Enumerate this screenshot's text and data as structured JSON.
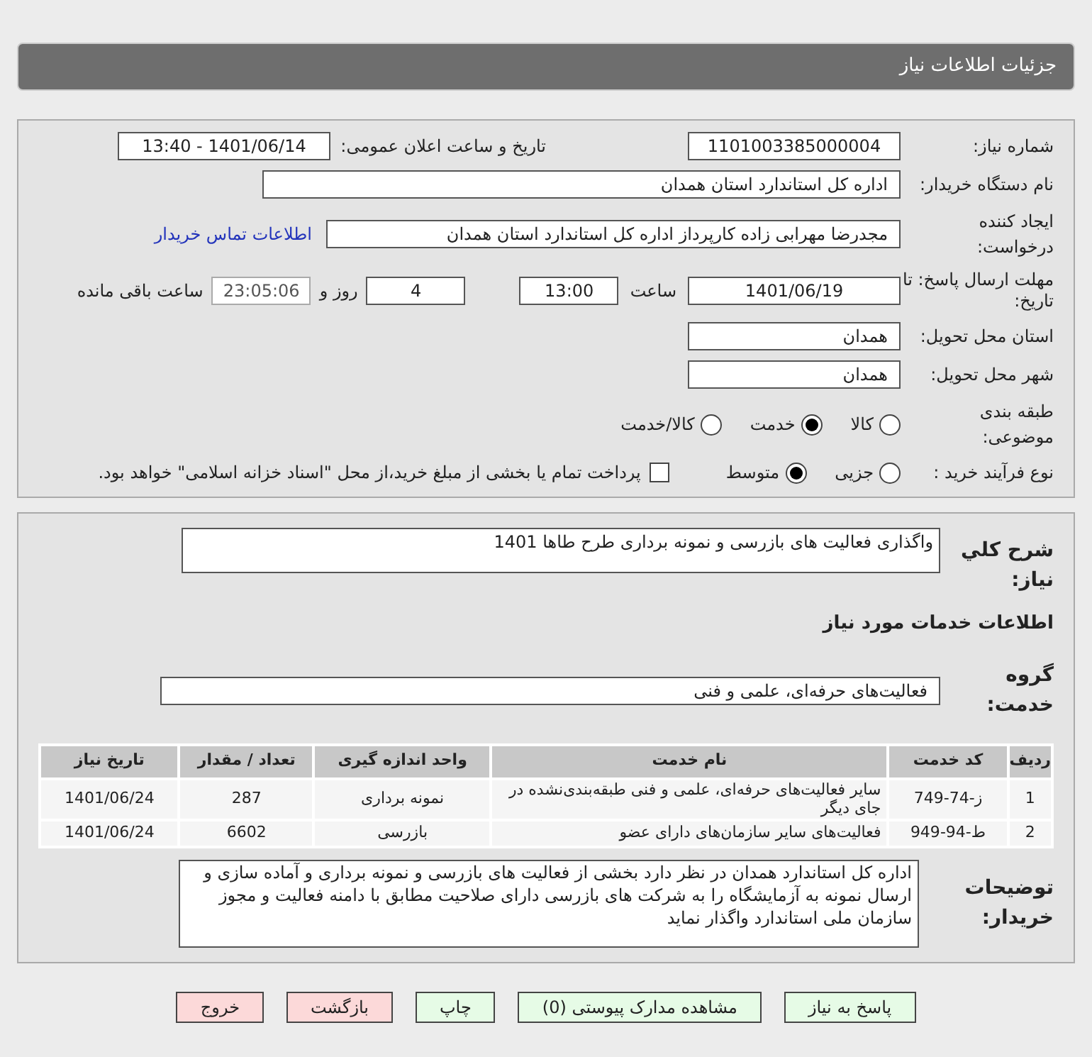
{
  "header": {
    "title": "جزئیات اطلاعات نیاز"
  },
  "fields": {
    "need_number": {
      "label": "شماره نیاز:",
      "value": "1101003385000004"
    },
    "announce": {
      "label": "تاریخ و ساعت اعلان عمومی:",
      "value": "1401/06/14 - 13:40"
    },
    "buyer": {
      "label": "نام دستگاه خریدار:",
      "value": "اداره کل استاندارد استان همدان"
    },
    "creator": {
      "label": "ایجاد کننده درخواست:",
      "value": "مجدرضا مهرابی زاده کارپرداز اداره کل استاندارد استان همدان",
      "link": "اطلاعات تماس خریدار"
    },
    "deadline": {
      "label": "مهلت ارسال پاسخ: تا تاریخ:",
      "date": "1401/06/19",
      "time_label": "ساعت",
      "time": "13:00",
      "days": "4",
      "days_label": "روز و",
      "remaining": "23:05:06",
      "remaining_label": "ساعت باقی مانده"
    },
    "province": {
      "label": "استان محل تحویل:",
      "value": "همدان"
    },
    "city": {
      "label": "شهر محل تحویل:",
      "value": "همدان"
    },
    "category": {
      "label": "طبقه بندی موضوعی:",
      "options": [
        {
          "label": "کالا",
          "selected": false
        },
        {
          "label": "خدمت",
          "selected": true
        },
        {
          "label": "کالا/خدمت",
          "selected": false
        }
      ]
    },
    "process": {
      "label": "نوع فرآیند خرید :",
      "options": [
        {
          "label": "جزیی",
          "selected": false
        },
        {
          "label": "متوسط",
          "selected": true
        }
      ],
      "payment": {
        "label": "پرداخت تمام یا بخشی از مبلغ خرید،از محل \"اسناد خزانه اسلامی\" خواهد بود.",
        "checked": false
      }
    }
  },
  "summary": {
    "label": "شرح کلي نياز:",
    "value": "واگذاری فعالیت های بازرسی و نمونه برداری طرح طاها 1401"
  },
  "services_title": "اطلاعات خدمات مورد نیاز",
  "service_group": {
    "label": "گروه خدمت:",
    "value": "فعالیت‌های حرفه‌ای، علمی و فنی"
  },
  "table": {
    "columns": [
      "ردیف",
      "کد خدمت",
      "نام خدمت",
      "واحد اندازه گیری",
      "تعداد / مقدار",
      "تاریخ نیاز"
    ],
    "rows": [
      [
        "1",
        "ز-74-749",
        "سایر فعالیت‌های حرفه‌ای، علمی و فنی طبقه‌بندی‌نشده در جای دیگر",
        "نمونه برداری",
        "287",
        "1401/06/24"
      ],
      [
        "2",
        "ط-94-949",
        "فعالیت‌های سایر سازمان‌های دارای عضو",
        "بازرسی",
        "6602",
        "1401/06/24"
      ]
    ]
  },
  "buyer_notes": {
    "label": "توضیحات خریدار:",
    "value": "اداره کل استاندارد همدان در نظر دارد بخشی از فعالیت های بازرسی و نمونه برداری و آماده سازی و ارسال نمونه به آزمایشگاه را به شرکت های بازرسی دارای صلاحیت مطابق با دامنه فعالیت و مجوز سازمان ملی استاندارد واگذار نماید"
  },
  "buttons": [
    {
      "label": "پاسخ به نیاز",
      "kind": "action"
    },
    {
      "label": "مشاهده مدارک پیوستی (0)",
      "kind": "action"
    },
    {
      "label": "چاپ",
      "kind": "action"
    },
    {
      "label": "بازگشت",
      "kind": "danger"
    },
    {
      "label": "خروج",
      "kind": "danger"
    }
  ]
}
